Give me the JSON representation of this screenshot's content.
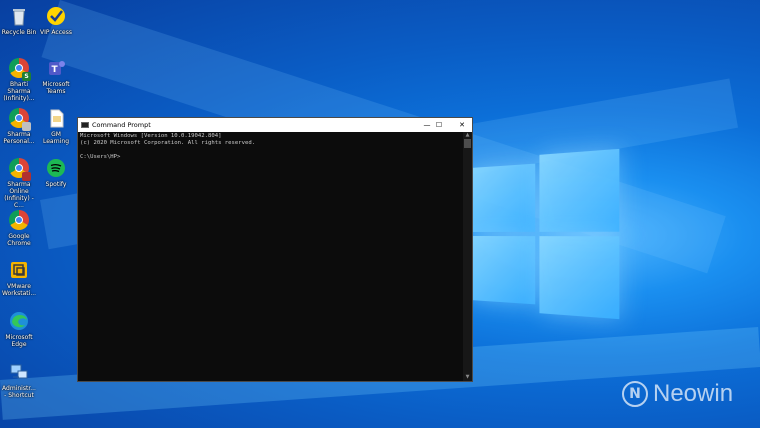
{
  "desktop": {
    "icons": [
      {
        "label": "Recycle Bin"
      },
      {
        "label": "VIP Access"
      },
      {
        "label": "Bharti Sharma\n(Infinity)..."
      },
      {
        "label": "Microsoft\nTeams"
      },
      {
        "label": "Sharma\nPersonal..."
      },
      {
        "label": "GM Learning"
      },
      {
        "label": "Sharma Online\n(Infinity) - C..."
      },
      {
        "label": "Spotify"
      },
      {
        "label": "Google\nChrome"
      },
      {
        "label": "VMware\nWorkstati..."
      },
      {
        "label": "Microsoft\nEdge"
      },
      {
        "label": "Administr...\n- Shortcut"
      }
    ]
  },
  "cmd_window": {
    "title": "Command Prompt",
    "controls": {
      "minimize": "—",
      "maximize": "☐",
      "close": "✕"
    },
    "lines": [
      "Microsoft Windows [Version 10.0.19042.804]",
      "(c) 2020 Microsoft Corporation. All rights reserved.",
      "",
      "C:\\Users\\HP>"
    ]
  },
  "watermark": {
    "text": "Neowin"
  },
  "colors": {
    "wallpaper_blue": "#0a5cc4",
    "console_bg": "#0c0c0c",
    "console_text": "#cccccc"
  }
}
